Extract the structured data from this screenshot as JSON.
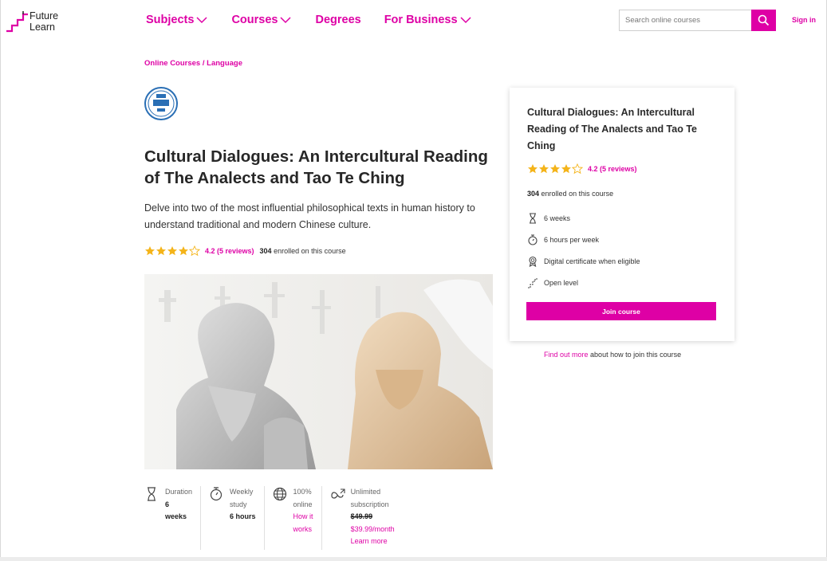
{
  "brand": {
    "logo_line1": "Future",
    "logo_line2": "Learn",
    "accent": "#de00a5"
  },
  "nav": {
    "items": [
      {
        "label": "Subjects",
        "has_dropdown": true
      },
      {
        "label": "Courses",
        "has_dropdown": true
      },
      {
        "label": "Degrees",
        "has_dropdown": false
      },
      {
        "label": "For Business",
        "has_dropdown": true
      }
    ]
  },
  "search": {
    "placeholder": "Search online courses",
    "icon": "search-icon"
  },
  "header": {
    "signin_label": "Sign in"
  },
  "breadcrumb": {
    "items": [
      "Online Courses",
      "Language"
    ],
    "separator": "/"
  },
  "course": {
    "title": "Cultural Dialogues: An Intercultural Reading of The Analects and Tao Te Ching",
    "description": "Delve into two of the most influential philosophical texts in human history to understand traditional and modern Chinese culture.",
    "rating_stars": 4.2,
    "rating_label": "4.2 (5 reviews)",
    "enrolled_count": "304",
    "enrolled_suffix": "enrolled on this course",
    "hero_image": "statues of Confucius and Socrates"
  },
  "features": [
    {
      "icon": "hourglass-icon",
      "label": "Duration",
      "value": "6",
      "value2": "weeks"
    },
    {
      "icon": "stopwatch-icon",
      "label": "Weekly",
      "label2": "study",
      "value": "6 hours"
    },
    {
      "icon": "globe-icon",
      "label": "100%",
      "label2": "online",
      "link1": "How it",
      "link2": "works"
    },
    {
      "icon": "infinity-icon",
      "label": "Unlimited",
      "label2": "subscription",
      "old_price": "$49.99",
      "price": "$39.99/month",
      "link": "Learn more"
    }
  ],
  "side_card": {
    "title": "Cultural Dialogues: An Intercultural Reading of The Analects and Tao Te Ching",
    "rating_label": "4.2 (5 reviews)",
    "enrolled_count": "304",
    "enrolled_suffix": "enrolled on this course",
    "details": [
      {
        "icon": "hourglass-icon",
        "text": "6 weeks"
      },
      {
        "icon": "stopwatch-icon",
        "text": "6 hours per week"
      },
      {
        "icon": "certificate-icon",
        "text": "Digital certificate when eligible"
      },
      {
        "icon": "steps-icon",
        "text": "Open level"
      }
    ],
    "join_label": "Join course"
  },
  "find_out": {
    "link": "Find out more",
    "text": "about how to join this course"
  }
}
